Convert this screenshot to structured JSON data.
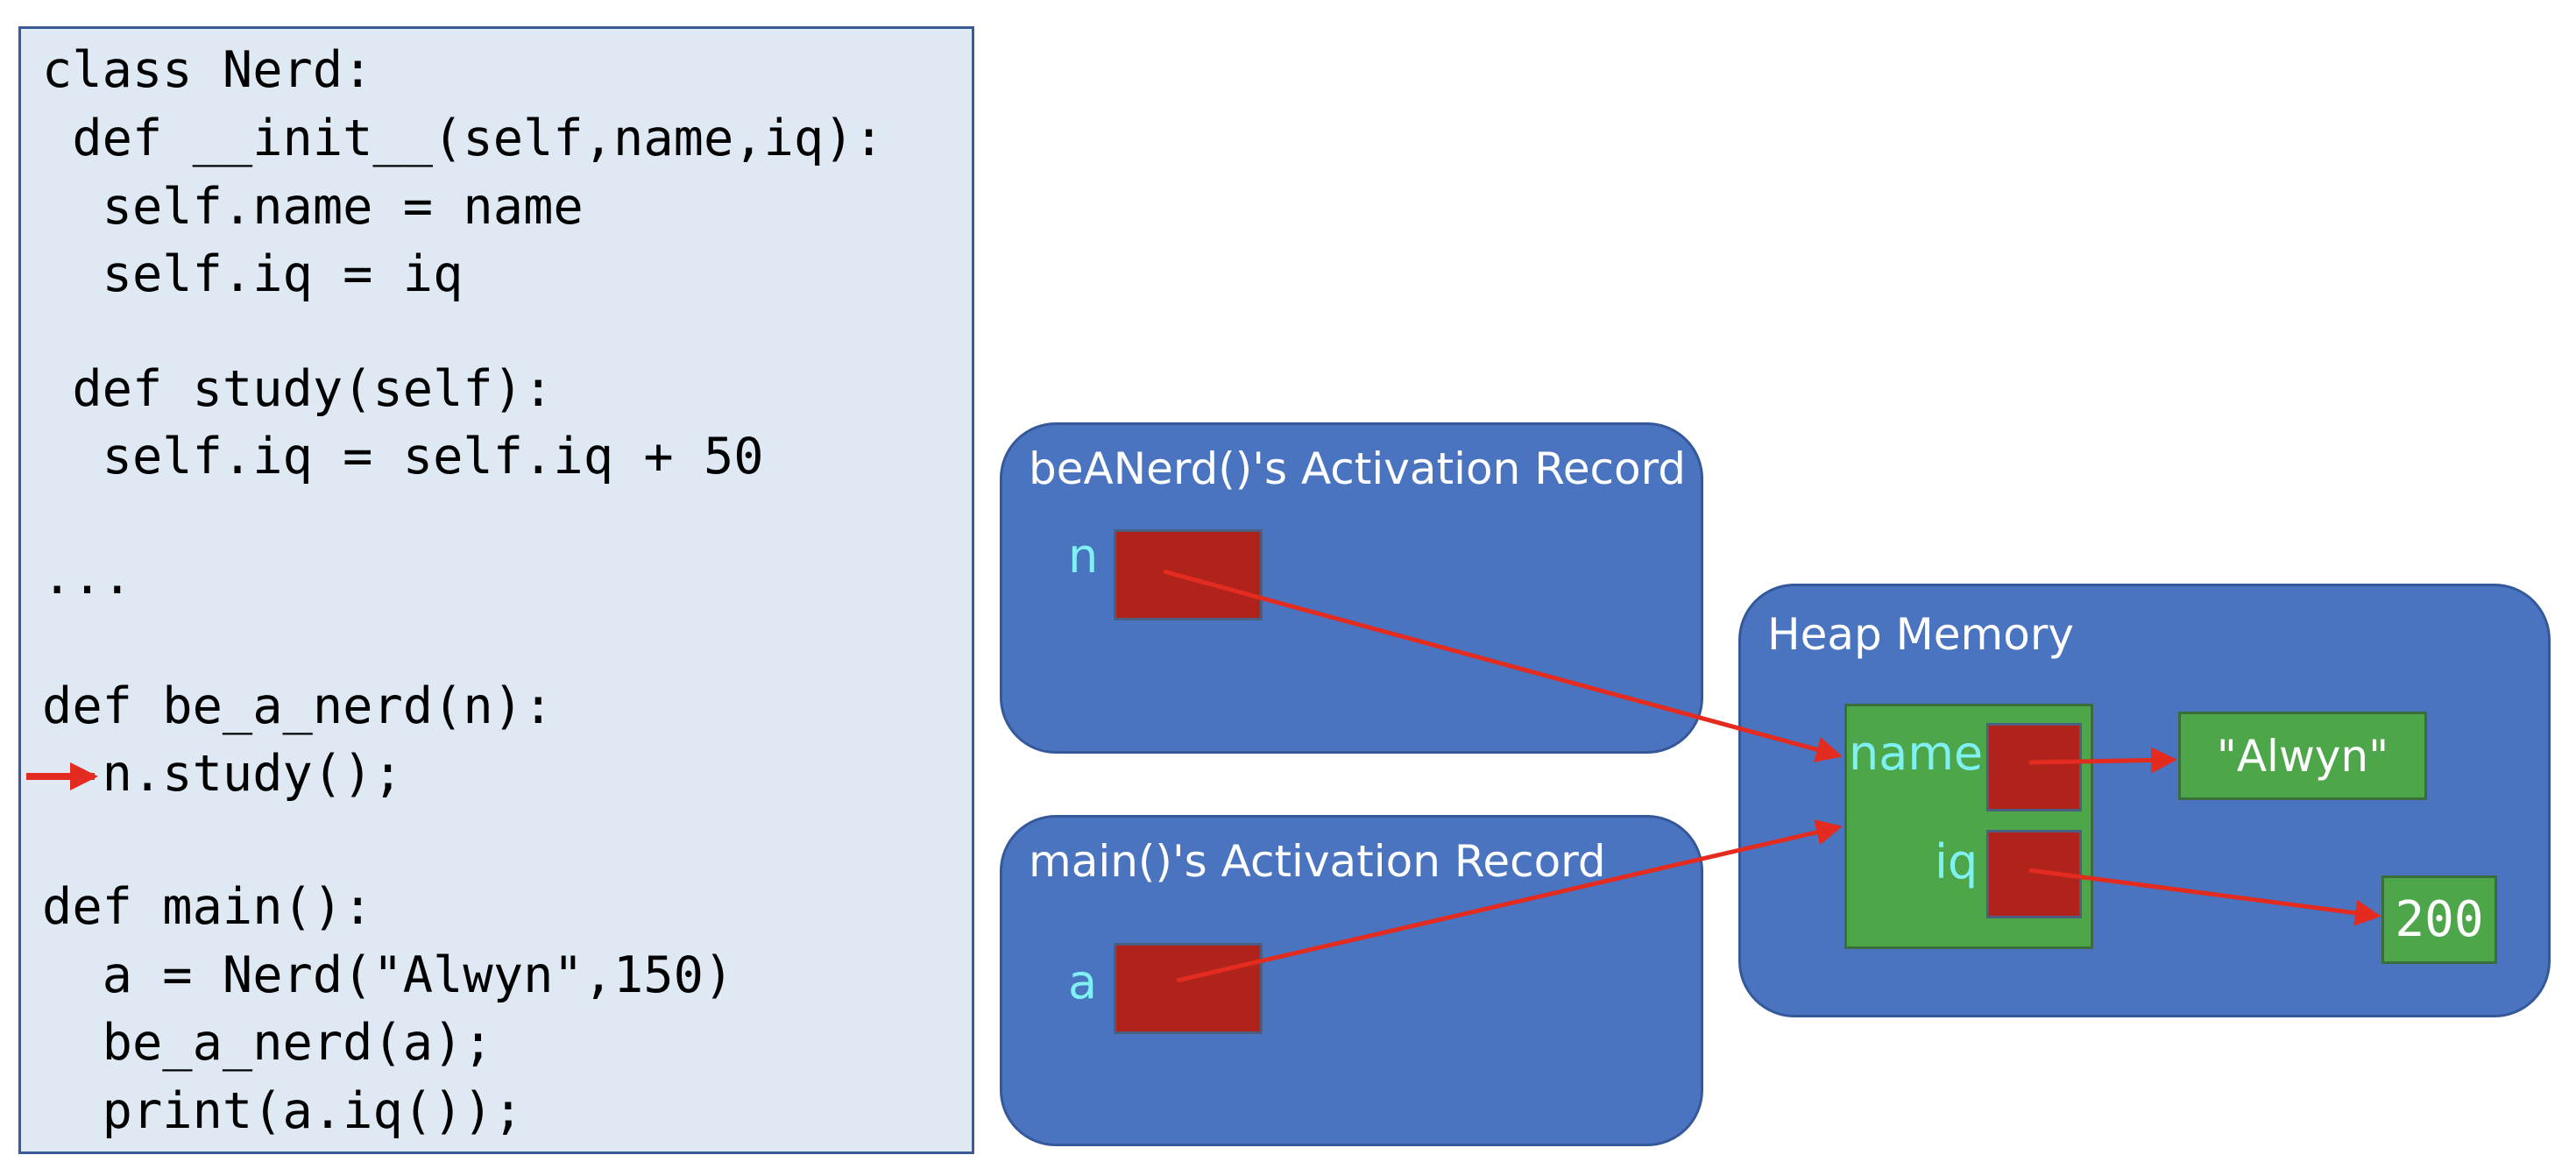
{
  "code": {
    "lines": [
      "class Nerd:",
      " def __init__(self,name,iq):",
      "  self.name = name",
      "  self.iq = iq",
      " def study(self):",
      "  self.iq = self.iq + 50",
      "...",
      "def be_a_nerd(n):",
      "  n.study();",
      "def main():",
      "  a = Nerd(\"Alwyn\",150)",
      "  be_a_nerd(a);",
      "  print(a.iq());"
    ],
    "current_line_index": 8
  },
  "frames": {
    "be_a_nerd": {
      "title": "beANerd()'s Activation Record",
      "var": "n"
    },
    "main": {
      "title": "main()'s Activation Record",
      "var": "a"
    }
  },
  "heap": {
    "title": "Heap Memory",
    "object": {
      "fields": [
        {
          "name": "name"
        },
        {
          "name": "iq"
        }
      ]
    },
    "values": {
      "name": "\"Alwyn\"",
      "iq": "200"
    }
  },
  "colors": {
    "code_bg": "#dfe9f4",
    "frame_bg": "#4a74bf",
    "reference": "#b0231b",
    "heap_object": "#4ea64a",
    "label": "#7ff0f4",
    "arrow": "#e32b20"
  }
}
